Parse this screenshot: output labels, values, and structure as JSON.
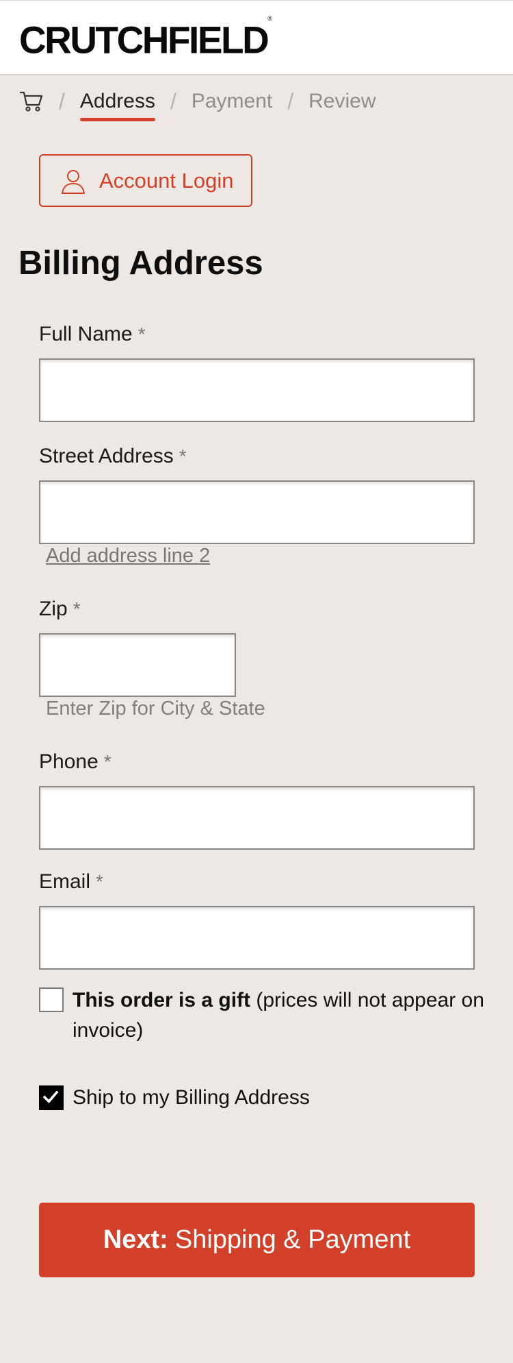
{
  "brand": {
    "logo_text": "CRUTCHFIELD",
    "logo_mark": "®"
  },
  "breadcrumb": {
    "cart_icon": "cart-icon",
    "separator": "/",
    "steps": [
      "Address",
      "Payment",
      "Review"
    ],
    "active_step": "Address"
  },
  "account_login": {
    "label": "Account Login",
    "icon": "user-icon"
  },
  "form": {
    "title": "Billing Address",
    "required_mark": "*",
    "full_name": {
      "label": "Full Name",
      "value": ""
    },
    "street_address": {
      "label": "Street Address",
      "value": ""
    },
    "add_address_line_2": "Add address line 2",
    "zip": {
      "label": "Zip",
      "value": "",
      "hint": "Enter Zip for City & State"
    },
    "phone": {
      "label": "Phone",
      "value": ""
    },
    "email": {
      "label": "Email",
      "value": ""
    },
    "gift": {
      "checked": false,
      "bold_text": "This order is a gift",
      "rest_text": " (prices will not appear on invoice)"
    },
    "ship_to_billing": {
      "checked": true,
      "label": "Ship to my Billing Address"
    }
  },
  "next_button": {
    "bold": "Next:",
    "label": "Shipping & Payment"
  },
  "colors": {
    "accent": "#d2402a",
    "background": "#ede8e3",
    "header": "#ffffff"
  }
}
